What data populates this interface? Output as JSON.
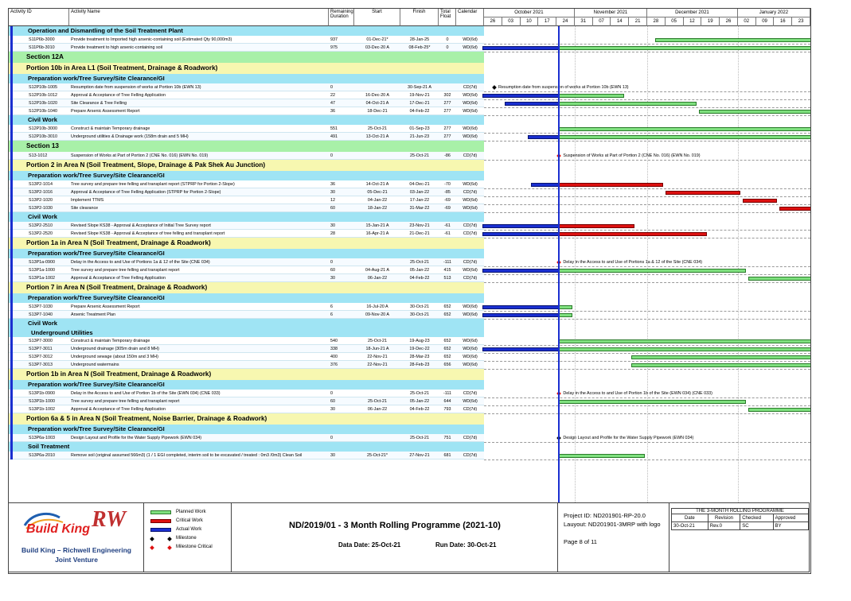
{
  "columns": {
    "activity_id": "Activity ID",
    "activity_name": "Activity Name",
    "remaining_duration": "Remaining Duration",
    "start": "Start",
    "finish": "Finish",
    "total_float": "Total Float",
    "calendar": "Calendar"
  },
  "months": [
    "October 2021",
    "November 2021",
    "December 2021",
    "January 2022"
  ],
  "weeks": [
    "26",
    "03",
    "10",
    "17",
    "24",
    "31",
    "07",
    "14",
    "21",
    "28",
    "05",
    "12",
    "19",
    "26",
    "02",
    "09",
    "16",
    "23"
  ],
  "rows": [
    {
      "type": "wbs",
      "level": 1,
      "text": "Operation and Dismantling of the Soil Treatment Plant",
      "color": "#9fe4f4"
    },
    {
      "type": "act",
      "id": "S11P6b-3000",
      "name": "Provide treatment to Imported high arsenic-containing soil (Estimated Qty 90,000m3)",
      "dur": "937",
      "start": "01-Dec-21*",
      "finish": "28-Jan-25",
      "float": "0",
      "cal": "WD(6d)"
    },
    {
      "type": "act",
      "id": "S11P6b-3010",
      "name": "Provide treatment to high arsenic-containing soil",
      "dur": "975",
      "start": "03-Dec-20 A",
      "finish": "08-Feb-25*",
      "float": "0",
      "cal": "WD(6d)"
    },
    {
      "type": "wbs",
      "level": 0,
      "text": "Section 12A",
      "color": "#a8f0a8"
    },
    {
      "type": "wbs",
      "level": 0,
      "text": "Portion 10b in Area L1   (Soil Treatment, Drainage & Roadwork)",
      "color": "#f7f7b0"
    },
    {
      "type": "wbs",
      "level": 1,
      "text": "Preparation work/Tree Survey/Site Clearance/GI",
      "color": "#9fe4f4"
    },
    {
      "type": "act",
      "id": "S12P10b-1005",
      "name": "Resumption date from suspension of works at Portion 10b (EWN 13)",
      "dur": "0",
      "start": "",
      "finish": "30-Sep-21 A",
      "float": "",
      "cal": "CD(7d)"
    },
    {
      "type": "act",
      "id": "S12P10b-1012",
      "name": "Approval & Acceptance of Tree Felling Application",
      "dur": "22",
      "start": "16-Dec-20 A",
      "finish": "19-Nov-21",
      "float": "302",
      "cal": "WD(6d)"
    },
    {
      "type": "act",
      "id": "S12P10b-1020",
      "name": "Site Clearance & Tree Felling",
      "dur": "47",
      "start": "04-Oct-21 A",
      "finish": "17-Dec-21",
      "float": "277",
      "cal": "WD(6d)"
    },
    {
      "type": "act",
      "id": "S12P10b-1040",
      "name": "Prepare Arsenic Assessment Report",
      "dur": "36",
      "start": "18-Dec-21",
      "finish": "04-Feb-22",
      "float": "277",
      "cal": "WD(6d)"
    },
    {
      "type": "wbs",
      "level": 1,
      "text": "Civil Work",
      "color": "#9fe4f4"
    },
    {
      "type": "act",
      "id": "S12P10b-3000",
      "name": "Construct & maintain Temporary drainage",
      "dur": "551",
      "start": "25-Oct-21",
      "finish": "01-Sep-23",
      "float": "277",
      "cal": "WD(6d)"
    },
    {
      "type": "act",
      "id": "S12P10b-3010",
      "name": "Underground utilities & Drainage work (158m drain and 5 MH)",
      "dur": "491",
      "start": "13-Oct-21 A",
      "finish": "21-Jun-23",
      "float": "277",
      "cal": "WD(6d)"
    },
    {
      "type": "wbs",
      "level": 0,
      "text": "Section 13",
      "color": "#a8f0a8"
    },
    {
      "type": "act",
      "id": "S13-1012",
      "name": "Suspension of Works at Part of Portion 2  (CNE No. 016) (EWN No. 019)",
      "dur": "0",
      "start": "",
      "finish": "25-Oct-21",
      "float": "-86",
      "cal": "CD(7d)"
    },
    {
      "type": "wbs",
      "level": 0,
      "text": "Portion 2 in Area N   (Soil Treatment, Slope, Drainage & Pak Shek Au Junction)",
      "color": "#f7f7b0"
    },
    {
      "type": "wbs",
      "level": 1,
      "text": "Preparation work/Tree Survey/Site Clearance/GI",
      "color": "#9fe4f4"
    },
    {
      "type": "act",
      "id": "S13P2-1014",
      "name": "Tree survey and prepare tree felling and transplant report (STPRP for Portion 2-Slope)",
      "dur": "36",
      "start": "14-Oct-21 A",
      "finish": "04-Dec-21",
      "float": "-70",
      "cal": "WD(6d)"
    },
    {
      "type": "act",
      "id": "S13P2-1016",
      "name": "Approval & Acceptance of Tree Felling Application (STPRP for Portion 2-Slope)",
      "dur": "30",
      "start": "05-Dec-21",
      "finish": "03-Jan-22",
      "float": "-85",
      "cal": "CD(7d)"
    },
    {
      "type": "act",
      "id": "S13P2-1020",
      "name": "Implement TTMS",
      "dur": "12",
      "start": "04-Jan-22",
      "finish": "17-Jan-22",
      "float": "-69",
      "cal": "WD(6d)"
    },
    {
      "type": "act",
      "id": "S13P2-1030",
      "name": "Site clearance",
      "dur": "60",
      "start": "18-Jan-22",
      "finish": "31-Mar-22",
      "float": "-69",
      "cal": "WD(6d)"
    },
    {
      "type": "wbs",
      "level": 1,
      "text": "Civil Work",
      "color": "#9fe4f4"
    },
    {
      "type": "act",
      "id": "S13P2-2510",
      "name": "Revised Slope KS38 - Approval & Acceptance of Initial Tree Survey report",
      "dur": "30",
      "start": "15-Jan-21 A",
      "finish": "23-Nov-21",
      "float": "-61",
      "cal": "CD(7d)"
    },
    {
      "type": "act",
      "id": "S13P2-2520",
      "name": "Revised Slope KS38 - Approval & Acceptance of tree felling and transplant report",
      "dur": "28",
      "start": "16-Apr-21 A",
      "finish": "21-Dec-21",
      "float": "-61",
      "cal": "CD(7d)"
    },
    {
      "type": "wbs",
      "level": 0,
      "text": "Portion 1a in Area N   (Soil Treatment, Drainage & Roadwork)",
      "color": "#f7f7b0"
    },
    {
      "type": "wbs",
      "level": 1,
      "text": "Preparation work/Tree Survey/Site Clearance/GI",
      "color": "#9fe4f4"
    },
    {
      "type": "act",
      "id": "S13P1a-0900",
      "name": "Delay in the Access to and Use of Portions 1a & 12 of the Site (CNE 034)",
      "dur": "0",
      "start": "",
      "finish": "25-Oct-21",
      "float": "-111",
      "cal": "CD(7d)"
    },
    {
      "type": "act",
      "id": "S13P1a-1000",
      "name": "Tree survey and prepare tree felling and transplant report",
      "dur": "60",
      "start": "04-Aug-21 A",
      "finish": "05-Jan-22",
      "float": "415",
      "cal": "WD(6d)"
    },
    {
      "type": "act",
      "id": "S13P1a-1002",
      "name": "Approval & Acceptance of Tree Felling Application",
      "dur": "30",
      "start": "06-Jan-22",
      "finish": "04-Feb-22",
      "float": "513",
      "cal": "CD(7d)"
    },
    {
      "type": "wbs",
      "level": 0,
      "text": "Portion 7 in Area N   (Soil Treatment, Drainage & Roadwork)",
      "color": "#f7f7b0"
    },
    {
      "type": "wbs",
      "level": 1,
      "text": "Preparation work/Tree Survey/Site Clearance/GI",
      "color": "#9fe4f4"
    },
    {
      "type": "act",
      "id": "S13P7-1030",
      "name": "Prepare Arsenic Assessment Report",
      "dur": "6",
      "start": "16-Jul-20 A",
      "finish": "30-Oct-21",
      "float": "652",
      "cal": "WD(6d)"
    },
    {
      "type": "act",
      "id": "S13P7-1040",
      "name": "Arsenic Treatment Plan",
      "dur": "6",
      "start": "09-Nov-20 A",
      "finish": "30-Oct-21",
      "float": "652",
      "cal": "WD(6d)"
    },
    {
      "type": "wbs",
      "level": 1,
      "text": "Civil Work",
      "color": "#9fe4f4"
    },
    {
      "type": "wbs",
      "level": 2,
      "text": "Underground Utilities",
      "color": "#9fe4f4"
    },
    {
      "type": "act",
      "id": "S13P7-3000",
      "name": "Construct & maintain Temporary drainage",
      "dur": "540",
      "start": "25-Oct-21",
      "finish": "19-Aug-23",
      "float": "652",
      "cal": "WD(6d)"
    },
    {
      "type": "act",
      "id": "S13P7-3011",
      "name": "Underground drainage (305m drain and 8 MH)",
      "dur": "338",
      "start": "18-Jun-21 A",
      "finish": "19-Dec-22",
      "float": "652",
      "cal": "WD(6d)"
    },
    {
      "type": "act",
      "id": "S13P7-3012",
      "name": "Underground sewage (about 150m and 3 MH)",
      "dur": "400",
      "start": "22-Nov-21",
      "finish": "28-Mar-23",
      "float": "652",
      "cal": "WD(6d)"
    },
    {
      "type": "act",
      "id": "S13P7-3013",
      "name": "Underground watermains",
      "dur": "376",
      "start": "22-Nov-21",
      "finish": "28-Feb-23",
      "float": "656",
      "cal": "WD(6d)"
    },
    {
      "type": "wbs",
      "level": 0,
      "text": "Portion 1b in Area N   (Soil Treatment, Drainage & Roadwork)",
      "color": "#f7f7b0"
    },
    {
      "type": "wbs",
      "level": 1,
      "text": "Preparation work/Tree Survey/Site Clearance/GI",
      "color": "#9fe4f4"
    },
    {
      "type": "act",
      "id": "S13P1b-0900",
      "name": "Delay in the Access to and Use of Portion 1b of the Site (EWN 034) (CNE 033)",
      "dur": "0",
      "start": "",
      "finish": "25-Oct-21",
      "float": "-111",
      "cal": "CD(7d)"
    },
    {
      "type": "act",
      "id": "S13P1b-1000",
      "name": "Tree survey and prepare tree felling and transplant report",
      "dur": "60",
      "start": "25-Oct-21",
      "finish": "05-Jan-22",
      "float": "644",
      "cal": "WD(6d)"
    },
    {
      "type": "act",
      "id": "S13P1b-1002",
      "name": "Approval & Acceptance of Tree Felling Application",
      "dur": "30",
      "start": "06-Jan-22",
      "finish": "04-Feb-22",
      "float": "793",
      "cal": "CD(7d)"
    },
    {
      "type": "wbs",
      "level": 0,
      "text": "Portion 6a & 5 in Area N   (Soil Treatment, Noise Barrier, Drainage & Roadwork)",
      "color": "#f7f7b0"
    },
    {
      "type": "wbs",
      "level": 1,
      "text": "Preparation work/Tree Survey/Site Clearance/GI",
      "color": "#9fe4f4"
    },
    {
      "type": "act",
      "id": "S13P6a-1003",
      "name": "Design Layout and Profile for the Water Supply Pipework (EWN 034)",
      "dur": "0",
      "start": "",
      "finish": "25-Oct-21",
      "float": "751",
      "cal": "CD(7d)"
    },
    {
      "type": "wbs",
      "level": 1,
      "text": "Soil Treatment",
      "color": "#9fe4f4"
    },
    {
      "type": "act",
      "id": "S13P6a-2010",
      "name": "Remove soil (original assumed 566m3) (1 / 1 EGI completed, interim soil to be excavated / treated : 0m3 /0m3) Clean Soil",
      "dur": "30",
      "start": "25-Oct-21*",
      "finish": "27-Nov-21",
      "float": "681",
      "cal": "CD(7d)"
    }
  ],
  "timeline_labels": [
    "Resumption date from suspension of works at Portion 10b (EWN 13)",
    "Suspension of Works at Part of Portion 2  (CNE No. 016) (EWN No. 019)",
    "Delay in the Access to and Use of Portions 1a & 12 of the Site (CNE 034)",
    "Delay in the Access to and Use of Portion 1b of the Site (EWN 034) (CNE 033)",
    "Design Layout and Profile for the Water Supply Pipework (EWN 034)"
  ],
  "footer": {
    "logo_name": "Build King",
    "logo_mark": "RW",
    "joint_venture_line1": "Build King – Richwell Engineering",
    "joint_venture_line2": "Joint Venture",
    "legend": {
      "planned": "Planned Work",
      "critical": "Critical Work",
      "actual": "Actual Work",
      "milestone": "Milestone",
      "milestone_critical": "Milestone Critical"
    },
    "title": "ND/2019/01 - 3 Month Rolling Programme (2021-10)",
    "data_date": "Data Date: 25-Oct-21",
    "run_date": "Run Date: 30-Oct-21",
    "project_id": "Project ID: ND201901-RP-20.0",
    "layout": "Lauyout: ND201901-3MRP with logo",
    "page": "Page 8 of 11",
    "rp_title": "THE 3-MONTH ROLLING PROGRAMME",
    "rp_headers": [
      "Date",
      "Revision",
      "Checked",
      "Approved"
    ],
    "rp_values": [
      "30-Oct-21",
      "Rev.0",
      "SC",
      "BY"
    ]
  },
  "colors": {
    "planned": "#7fe07f",
    "critical": "#dd1111",
    "actual": "#1a2fd0",
    "section": "#a8f0a8",
    "portion": "#f7f7b0",
    "group": "#9fe4f4"
  }
}
